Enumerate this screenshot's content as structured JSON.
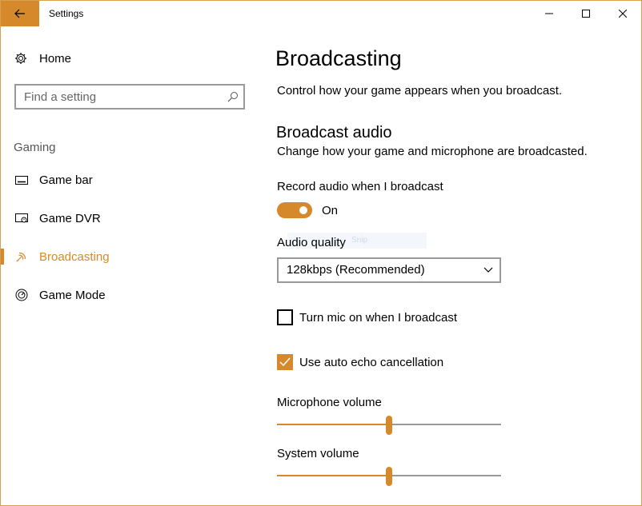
{
  "window": {
    "title": "Settings",
    "accent": "#d5892a",
    "controls": [
      "minimize-icon",
      "maximize-icon",
      "close-icon"
    ]
  },
  "sidebar": {
    "home": {
      "label": "Home",
      "icon": "gear-icon"
    },
    "search": {
      "placeholder": "Find a setting",
      "value": ""
    },
    "section_label": "Gaming",
    "items": [
      {
        "label": "Game bar",
        "icon": "game-bar-icon",
        "selected": false
      },
      {
        "label": "Game DVR",
        "icon": "game-dvr-icon",
        "selected": false
      },
      {
        "label": "Broadcasting",
        "icon": "broadcasting-icon",
        "selected": true
      },
      {
        "label": "Game Mode",
        "icon": "game-mode-icon",
        "selected": false
      }
    ]
  },
  "main": {
    "title": "Broadcasting",
    "description": "Control how your game appears when you broadcast.",
    "audio_section": {
      "title": "Broadcast audio",
      "description": "Change how your game and microphone are broadcasted."
    },
    "record_audio": {
      "label": "Record audio when I broadcast",
      "state_text": "On",
      "on": true
    },
    "snip_overlay": "Snip",
    "audio_quality": {
      "label": "Audio quality",
      "selected": "128kbps (Recommended)"
    },
    "mic_on": {
      "label": "Turn mic on when I broadcast",
      "checked": false
    },
    "echo_cancel": {
      "label": "Use auto echo cancellation",
      "checked": true
    },
    "mic_volume": {
      "label": "Microphone volume",
      "level": 0.5
    },
    "system_volume": {
      "label": "System volume",
      "level": 0.5
    }
  }
}
